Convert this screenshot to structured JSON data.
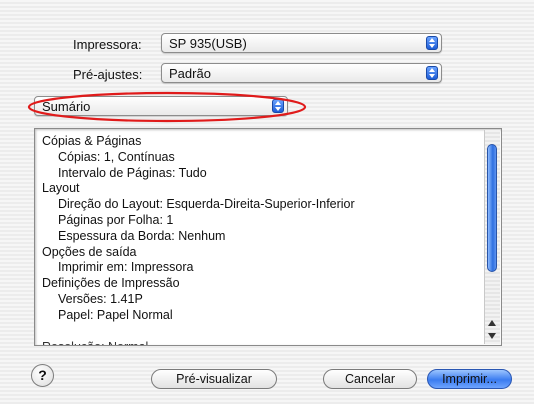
{
  "printer": {
    "label": "Impressora:",
    "value": "SP 935(USB)"
  },
  "presets": {
    "label": "Pré-ajustes:",
    "value": "Padrão"
  },
  "section": {
    "value": "Sumário"
  },
  "summary": {
    "lines": [
      {
        "text": "Cópias & Páginas",
        "indent": 0
      },
      {
        "text": "Cópias:  1, Contínuas",
        "indent": 1
      },
      {
        "text": "Intervalo de Páginas:  Tudo",
        "indent": 1
      },
      {
        "text": "Layout",
        "indent": 0
      },
      {
        "text": "Direção do Layout:  Esquerda-Direita-Superior-Inferior",
        "indent": 1
      },
      {
        "text": "Páginas por Folha:  1",
        "indent": 1
      },
      {
        "text": "Espessura da Borda:  Nenhum",
        "indent": 1
      },
      {
        "text": "Opções de saída",
        "indent": 0
      },
      {
        "text": "Imprimir em:  Impressora",
        "indent": 1
      },
      {
        "text": "Definições de Impressão",
        "indent": 0
      },
      {
        "text": "Versões:  1.41P",
        "indent": 1
      },
      {
        "text": "Papel:  Papel Normal",
        "indent": 1
      }
    ]
  },
  "buttons": {
    "help": "?",
    "preview": "Pré-visualizar",
    "cancel": "Cancelar",
    "print": "Imprimir..."
  },
  "colors": {
    "highlight_oval": "#e01b1b",
    "accent": "#3b7cf0"
  }
}
